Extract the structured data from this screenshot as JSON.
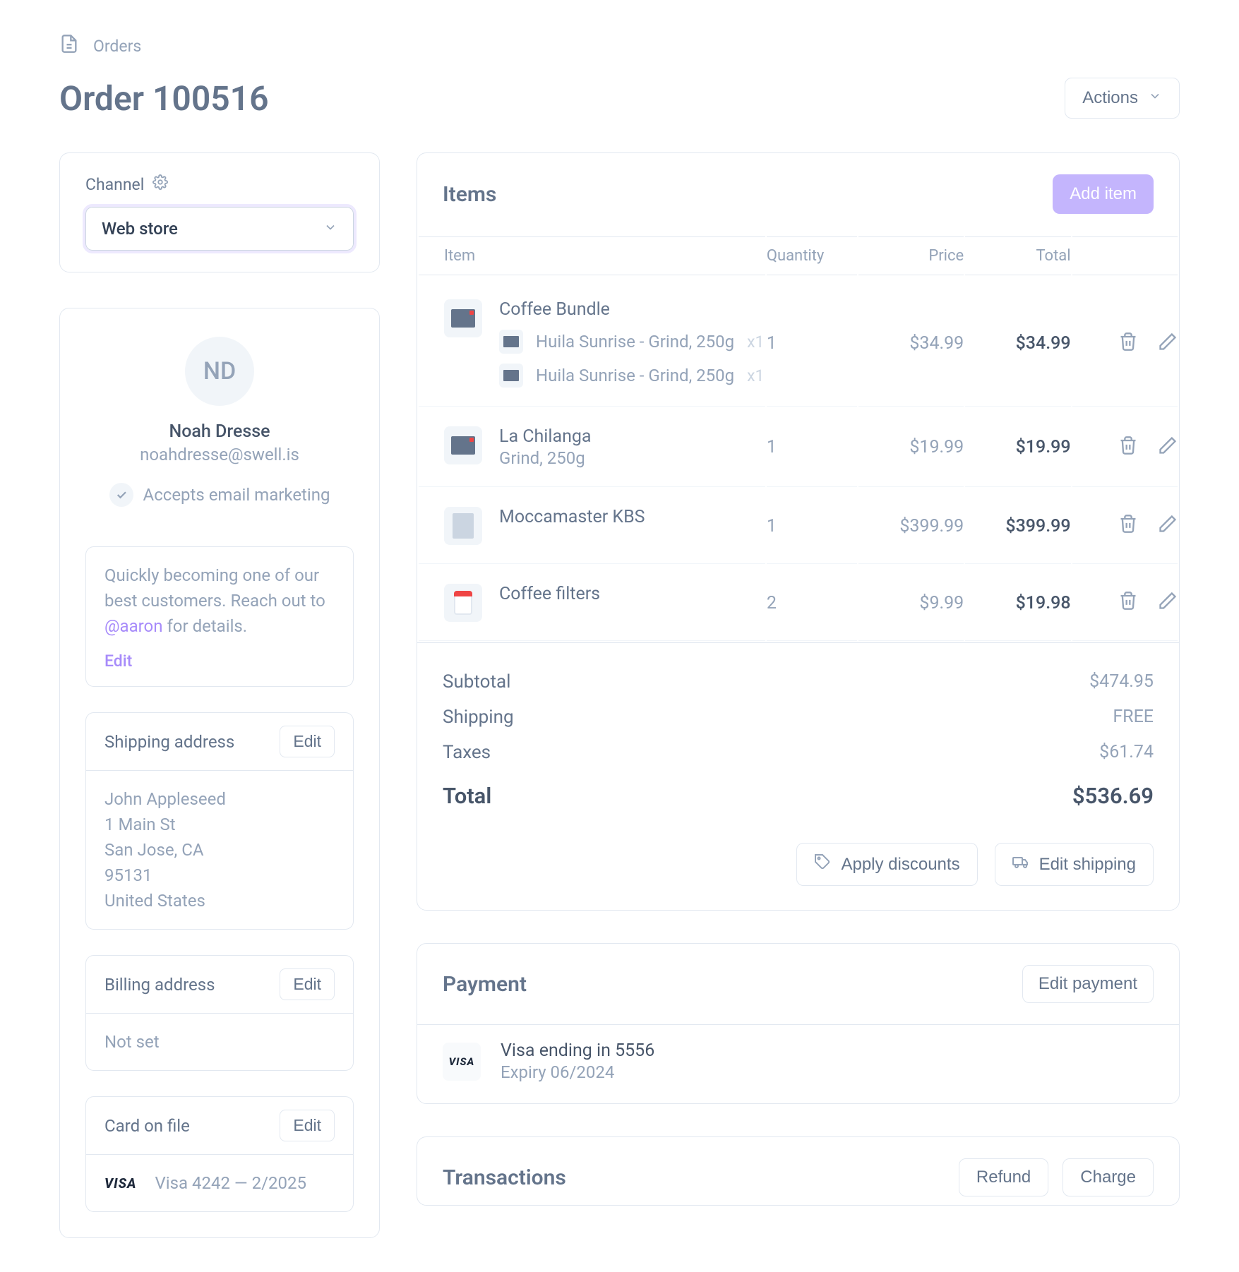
{
  "breadcrumb": {
    "label": "Orders"
  },
  "header": {
    "title": "Order 100516",
    "actions_label": "Actions"
  },
  "channel": {
    "label": "Channel",
    "value": "Web store"
  },
  "customer": {
    "initials": "ND",
    "name": "Noah Dresse",
    "email": "noahdresse@swell.is",
    "accepts_label": "Accepts email marketing",
    "note_prefix": "Quickly becoming one of our best customers. Reach out to ",
    "note_mention": "@aaron",
    "note_suffix": " for details.",
    "edit_label": "Edit"
  },
  "shipping": {
    "title": "Shipping address",
    "edit_label": "Edit",
    "lines": [
      "John Appleseed",
      "1 Main St",
      "San Jose, CA",
      "95131",
      "United States"
    ]
  },
  "billing": {
    "title": "Billing address",
    "edit_label": "Edit",
    "value": "Not set"
  },
  "card_on_file": {
    "title": "Card on file",
    "edit_label": "Edit",
    "brand": "VISA",
    "label": "Visa 4242 — 2/2025"
  },
  "items": {
    "title": "Items",
    "add_label": "Add item",
    "columns": {
      "item": "Item",
      "qty": "Quantity",
      "price": "Price",
      "total": "Total"
    },
    "rows": [
      {
        "name": "Coffee Bundle",
        "subtitle": "",
        "qty": "1",
        "price": "$34.99",
        "total": "$34.99",
        "children": [
          {
            "label": "Huila Sunrise - Grind, 250g",
            "qty": "x1"
          },
          {
            "label": "Huila Sunrise - Grind, 250g",
            "qty": "x1"
          }
        ]
      },
      {
        "name": "La Chilanga",
        "subtitle": "Grind, 250g",
        "qty": "1",
        "price": "$19.99",
        "total": "$19.99",
        "children": []
      },
      {
        "name": "Moccamaster KBS",
        "subtitle": "",
        "qty": "1",
        "price": "$399.99",
        "total": "$399.99",
        "children": []
      },
      {
        "name": "Coffee filters",
        "subtitle": "",
        "qty": "2",
        "price": "$9.99",
        "total": "$19.98",
        "children": []
      }
    ],
    "subtotal_label": "Subtotal",
    "subtotal": "$474.95",
    "shipping_label": "Shipping",
    "shipping": "FREE",
    "taxes_label": "Taxes",
    "taxes": "$61.74",
    "total_label": "Total",
    "total": "$536.69",
    "apply_discounts_label": "Apply discounts",
    "edit_shipping_label": "Edit shipping"
  },
  "payment": {
    "title": "Payment",
    "edit_label": "Edit payment",
    "brand": "VISA",
    "primary": "Visa ending in 5556",
    "secondary": "Expiry 06/2024"
  },
  "transactions": {
    "title": "Transactions",
    "refund_label": "Refund",
    "charge_label": "Charge"
  }
}
